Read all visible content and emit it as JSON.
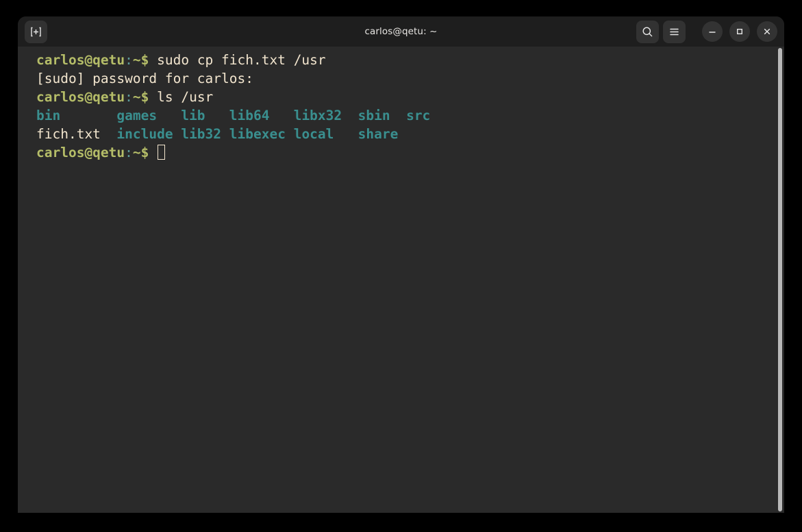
{
  "window": {
    "title": "carlos@qetu: ~",
    "titlebar": {
      "new_tab_label": "New Tab",
      "search_label": "Search",
      "menu_label": "Main Menu",
      "minimize_label": "Minimize",
      "maximize_label": "Maximize",
      "close_label": "Close"
    }
  },
  "theme": {
    "desktop_bg": "#000000",
    "titlebar_bg": "#1e1e1e",
    "terminal_bg": "#2a2a2a",
    "foreground": "#f2e5ce",
    "prompt_user": "#b5bd68",
    "prompt_punct": "#5c9c9c",
    "dir_color": "#3a8f8f",
    "scrollbar": "#b9b9b9"
  },
  "terminal": {
    "prompt": {
      "user_host": "carlos@qetu",
      "colon": ":",
      "path_sigil": "~$"
    },
    "lines": [
      {
        "type": "prompt",
        "command": " sudo cp fich.txt /usr"
      },
      {
        "type": "output",
        "text": "[sudo] password for carlos:"
      },
      {
        "type": "prompt",
        "command": " ls /usr"
      },
      {
        "type": "ls-row",
        "cells": [
          {
            "text": "bin",
            "kind": "dir",
            "width": 10
          },
          {
            "text": "games",
            "kind": "dir",
            "width": 8
          },
          {
            "text": "lib",
            "kind": "dir",
            "width": 6
          },
          {
            "text": "lib64",
            "kind": "dir",
            "width": 8
          },
          {
            "text": "libx32",
            "kind": "dir",
            "width": 8
          },
          {
            "text": "sbin",
            "kind": "dir",
            "width": 6
          },
          {
            "text": "src",
            "kind": "dir",
            "width": 3
          }
        ]
      },
      {
        "type": "ls-row",
        "cells": [
          {
            "text": "fich.txt",
            "kind": "file",
            "width": 10
          },
          {
            "text": "include",
            "kind": "dir",
            "width": 8
          },
          {
            "text": "lib32",
            "kind": "dir",
            "width": 6
          },
          {
            "text": "libexec",
            "kind": "dir",
            "width": 8
          },
          {
            "text": "local",
            "kind": "dir",
            "width": 8
          },
          {
            "text": "share",
            "kind": "dir",
            "width": 6
          }
        ]
      },
      {
        "type": "prompt-cursor",
        "command": " "
      }
    ]
  }
}
